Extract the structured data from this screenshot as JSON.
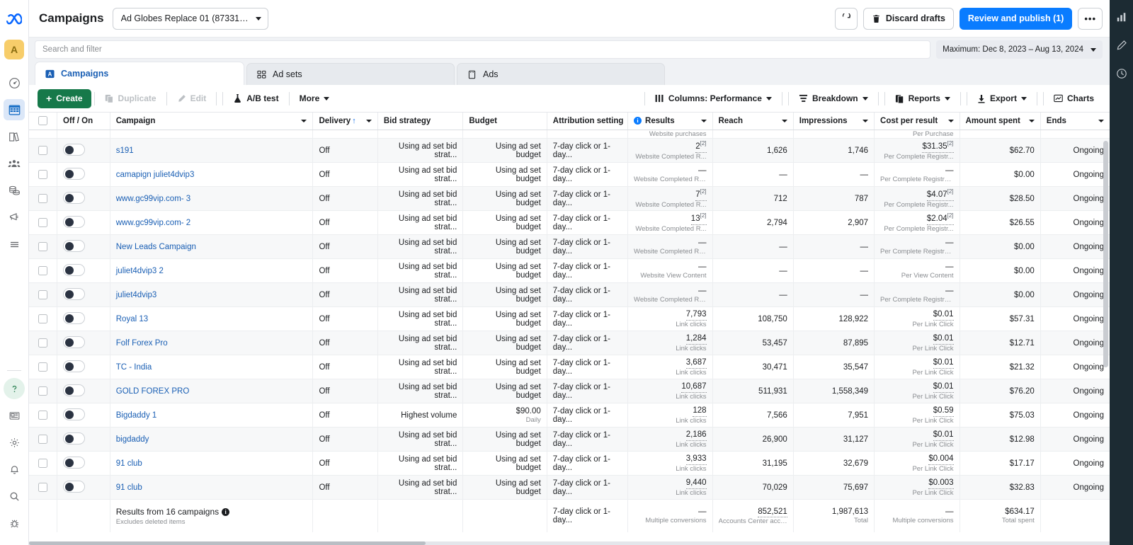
{
  "left_rail": {
    "logo": "meta-logo",
    "avatar_initial": "A",
    "items": [
      {
        "name": "dashboard-speedometer-icon"
      },
      {
        "name": "campaigns-grid-icon",
        "active": true
      },
      {
        "name": "library-books-icon"
      },
      {
        "name": "audiences-people-icon"
      },
      {
        "name": "billing-coins-icon"
      },
      {
        "name": "ads-megaphone-icon"
      },
      {
        "name": "all-tools-menu-icon"
      }
    ],
    "bottom_items": [
      {
        "name": "help-question-icon"
      },
      {
        "name": "news-feed-icon"
      },
      {
        "name": "settings-gear-icon"
      },
      {
        "name": "notifications-bell-icon"
      },
      {
        "name": "search-magnifier-icon"
      },
      {
        "name": "debug-bug-icon"
      }
    ]
  },
  "right_rail": {
    "items": [
      {
        "name": "analytics-bars-icon"
      },
      {
        "name": "edit-pencil-icon"
      },
      {
        "name": "history-clock-icon"
      }
    ]
  },
  "header": {
    "title": "Campaigns",
    "account_selector": "Ad Globes Replace 01 (87331078101...",
    "refresh_label": "",
    "discard_drafts_label": "Discard drafts",
    "review_publish_label": "Review and publish (1)",
    "more_options_label": "•••"
  },
  "search": {
    "placeholder": "Search and filter",
    "date_range": "Maximum: Dec 8, 2023 – Aug 13, 2024"
  },
  "tabs": [
    {
      "label": "Campaigns",
      "icon": "campaigns-tab-icon",
      "active": true
    },
    {
      "label": "Ad sets",
      "icon": "adsets-tab-icon",
      "active": false
    },
    {
      "label": "Ads",
      "icon": "ads-tab-icon",
      "active": false
    }
  ],
  "toolbar": {
    "create_label": "Create",
    "duplicate_label": "Duplicate",
    "edit_label": "Edit",
    "abtest_label": "A/B test",
    "more_label": "More",
    "columns_label": "Columns: Performance",
    "breakdown_label": "Breakdown",
    "reports_label": "Reports",
    "export_label": "Export",
    "charts_label": "Charts"
  },
  "table": {
    "columns": [
      {
        "key": "checkbox",
        "label": ""
      },
      {
        "key": "offon",
        "label": "Off / On"
      },
      {
        "key": "campaign",
        "label": "Campaign",
        "caret": true
      },
      {
        "key": "delivery",
        "label": "Delivery",
        "sort": "↑",
        "caret": true
      },
      {
        "key": "bid_strategy",
        "label": "Bid strategy"
      },
      {
        "key": "budget",
        "label": "Budget"
      },
      {
        "key": "attribution",
        "label": "Attribution setting"
      },
      {
        "key": "results",
        "label": "Results",
        "info": true,
        "caret": true
      },
      {
        "key": "reach",
        "label": "Reach",
        "caret": true
      },
      {
        "key": "impressions",
        "label": "Impressions",
        "caret": true
      },
      {
        "key": "cost_per_result",
        "label": "Cost per result",
        "caret": true
      },
      {
        "key": "amount_spent",
        "label": "Amount spent",
        "caret": true
      },
      {
        "key": "ends",
        "label": "Ends",
        "caret": true
      }
    ],
    "rows": [
      {
        "campaign": "s191",
        "delivery": "Off",
        "bid_strategy": "Using ad set bid strat...",
        "budget": "Using ad set budget",
        "budget_sub": "",
        "attribution": "7-day click or 1-day...",
        "results": "2",
        "results_sup": "[2]",
        "results_sub": "Website Completed R...",
        "reach": "1,626",
        "impressions": "1,746",
        "cost_per_result": "$31.35",
        "cpr_sup": "[2]",
        "cpr_sub": "Per Complete Registr...",
        "amount_spent": "$62.70",
        "ends": "Ongoing"
      },
      {
        "campaign": "camapign juliet4dvip3",
        "delivery": "Off",
        "bid_strategy": "Using ad set bid strat...",
        "budget": "Using ad set budget",
        "budget_sub": "",
        "attribution": "7-day click or 1-day...",
        "results": "—",
        "results_sup": "",
        "results_sub": "Website Completed Reg...",
        "reach": "—",
        "impressions": "—",
        "cost_per_result": "—",
        "cpr_sup": "",
        "cpr_sub": "Per Complete Registration",
        "amount_spent": "$0.00",
        "ends": "Ongoing"
      },
      {
        "campaign": "www.gc99vip.com- 3",
        "delivery": "Off",
        "bid_strategy": "Using ad set bid strat...",
        "budget": "Using ad set budget",
        "budget_sub": "",
        "attribution": "7-day click or 1-day...",
        "results": "7",
        "results_sup": "[2]",
        "results_sub": "Website Completed R...",
        "reach": "712",
        "impressions": "787",
        "cost_per_result": "$4.07",
        "cpr_sup": "[2]",
        "cpr_sub": "Per Complete Registr...",
        "amount_spent": "$28.50",
        "ends": "Ongoing"
      },
      {
        "campaign": "www.gc99vip.com- 2",
        "delivery": "Off",
        "bid_strategy": "Using ad set bid strat...",
        "budget": "Using ad set budget",
        "budget_sub": "",
        "attribution": "7-day click or 1-day...",
        "results": "13",
        "results_sup": "[2]",
        "results_sub": "Website Completed R...",
        "reach": "2,794",
        "impressions": "2,907",
        "cost_per_result": "$2.04",
        "cpr_sup": "[2]",
        "cpr_sub": "Per Complete Registr...",
        "amount_spent": "$26.55",
        "ends": "Ongoing"
      },
      {
        "campaign": "New Leads Campaign",
        "delivery": "Off",
        "bid_strategy": "Using ad set bid strat...",
        "budget": "Using ad set budget",
        "budget_sub": "",
        "attribution": "7-day click or 1-day...",
        "results": "—",
        "results_sup": "",
        "results_sub": "Website Completed Reg...",
        "reach": "—",
        "impressions": "—",
        "cost_per_result": "—",
        "cpr_sup": "",
        "cpr_sub": "Per Complete Registration",
        "amount_spent": "$0.00",
        "ends": "Ongoing"
      },
      {
        "campaign": "juliet4dvip3 2",
        "delivery": "Off",
        "bid_strategy": "Using ad set bid strat...",
        "budget": "Using ad set budget",
        "budget_sub": "",
        "attribution": "7-day click or 1-day...",
        "results": "—",
        "results_sup": "",
        "results_sub": "Website View Content",
        "reach": "—",
        "impressions": "—",
        "cost_per_result": "—",
        "cpr_sup": "",
        "cpr_sub": "Per View Content",
        "amount_spent": "$0.00",
        "ends": "Ongoing"
      },
      {
        "campaign": "juliet4dvip3",
        "delivery": "Off",
        "bid_strategy": "Using ad set bid strat...",
        "budget": "Using ad set budget",
        "budget_sub": "",
        "attribution": "7-day click or 1-day...",
        "results": "—",
        "results_sup": "",
        "results_sub": "Website Completed Reg...",
        "reach": "—",
        "impressions": "—",
        "cost_per_result": "—",
        "cpr_sup": "",
        "cpr_sub": "Per Complete Registration",
        "amount_spent": "$0.00",
        "ends": "Ongoing"
      },
      {
        "campaign": "Royal 13",
        "delivery": "Off",
        "bid_strategy": "Using ad set bid strat...",
        "budget": "Using ad set budget",
        "budget_sub": "",
        "attribution": "7-day click or 1-day...",
        "results": "7,793",
        "results_sup": "",
        "results_sub": "Link clicks",
        "reach": "108,750",
        "impressions": "128,922",
        "cost_per_result": "$0.01",
        "cpr_sup": "",
        "cpr_sub": "Per Link Click",
        "amount_spent": "$57.31",
        "ends": "Ongoing"
      },
      {
        "campaign": "Folf Forex Pro",
        "delivery": "Off",
        "bid_strategy": "Using ad set bid strat...",
        "budget": "Using ad set budget",
        "budget_sub": "",
        "attribution": "7-day click or 1-day...",
        "results": "1,284",
        "results_sup": "",
        "results_sub": "Link clicks",
        "reach": "53,457",
        "impressions": "87,895",
        "cost_per_result": "$0.01",
        "cpr_sup": "",
        "cpr_sub": "Per Link Click",
        "amount_spent": "$12.71",
        "ends": "Ongoing"
      },
      {
        "campaign": "TC - India",
        "delivery": "Off",
        "bid_strategy": "Using ad set bid strat...",
        "budget": "Using ad set budget",
        "budget_sub": "",
        "attribution": "7-day click or 1-day...",
        "results": "3,687",
        "results_sup": "",
        "results_sub": "Link clicks",
        "reach": "30,471",
        "impressions": "35,547",
        "cost_per_result": "$0.01",
        "cpr_sup": "",
        "cpr_sub": "Per Link Click",
        "amount_spent": "$21.32",
        "ends": "Ongoing"
      },
      {
        "campaign": "GOLD FOREX PRO",
        "delivery": "Off",
        "bid_strategy": "Using ad set bid strat...",
        "budget": "Using ad set budget",
        "budget_sub": "",
        "attribution": "7-day click or 1-day...",
        "results": "10,687",
        "results_sup": "",
        "results_sub": "Link clicks",
        "reach": "511,931",
        "impressions": "1,558,349",
        "cost_per_result": "$0.01",
        "cpr_sup": "",
        "cpr_sub": "Per Link Click",
        "amount_spent": "$76.20",
        "ends": "Ongoing"
      },
      {
        "campaign": "Bigdaddy 1",
        "delivery": "Off",
        "bid_strategy": "Highest volume",
        "budget": "$90.00",
        "budget_sub": "Daily",
        "attribution": "7-day click or 1-day...",
        "results": "128",
        "results_sup": "",
        "results_sub": "Link clicks",
        "reach": "7,566",
        "impressions": "7,951",
        "cost_per_result": "$0.59",
        "cpr_sup": "",
        "cpr_sub": "Per Link Click",
        "amount_spent": "$75.03",
        "ends": "Ongoing"
      },
      {
        "campaign": "bigdaddy",
        "delivery": "Off",
        "bid_strategy": "Using ad set bid strat...",
        "budget": "Using ad set budget",
        "budget_sub": "",
        "attribution": "7-day click or 1-day...",
        "results": "2,186",
        "results_sup": "",
        "results_sub": "Link clicks",
        "reach": "26,900",
        "impressions": "31,127",
        "cost_per_result": "$0.01",
        "cpr_sup": "",
        "cpr_sub": "Per Link Click",
        "amount_spent": "$12.98",
        "ends": "Ongoing"
      },
      {
        "campaign": "91 club",
        "delivery": "Off",
        "bid_strategy": "Using ad set bid strat...",
        "budget": "Using ad set budget",
        "budget_sub": "",
        "attribution": "7-day click or 1-day...",
        "results": "3,933",
        "results_sup": "",
        "results_sub": "Link clicks",
        "reach": "31,195",
        "impressions": "32,679",
        "cost_per_result": "$0.004",
        "cpr_sup": "",
        "cpr_sub": "Per Link Click",
        "amount_spent": "$17.17",
        "ends": "Ongoing"
      },
      {
        "campaign": "91 club",
        "delivery": "Off",
        "bid_strategy": "Using ad set bid strat...",
        "budget": "Using ad set budget",
        "budget_sub": "",
        "attribution": "7-day click or 1-day...",
        "results": "9,440",
        "results_sup": "",
        "results_sub": "Link clicks",
        "reach": "70,029",
        "impressions": "75,697",
        "cost_per_result": "$0.003",
        "cpr_sup": "",
        "cpr_sub": "Per Link Click",
        "amount_spent": "$32.83",
        "ends": "Ongoing"
      }
    ],
    "clipped_row_above": {
      "results_sub": "Website purchases",
      "cpr_sub": "Per Purchase"
    },
    "summary": {
      "title": "Results from 16 campaigns",
      "subtitle": "Excludes deleted items",
      "attribution": "7-day click or 1-day...",
      "results": "—",
      "results_sub": "Multiple conversions",
      "reach": "852,521",
      "reach_sub": "Accounts Center accou...",
      "impressions": "1,987,613",
      "impressions_sub": "Total",
      "cost_per_result": "—",
      "cpr_sub": "Multiple conversions",
      "amount_spent": "$634.17",
      "amount_spent_sub": "Total spent"
    }
  },
  "colors": {
    "brand_blue": "#0a7cff",
    "create_green": "#16794a",
    "link_blue": "#1a5fb4",
    "right_rail": "#1c2b33",
    "avatar_yellow": "#f7cd6a"
  }
}
